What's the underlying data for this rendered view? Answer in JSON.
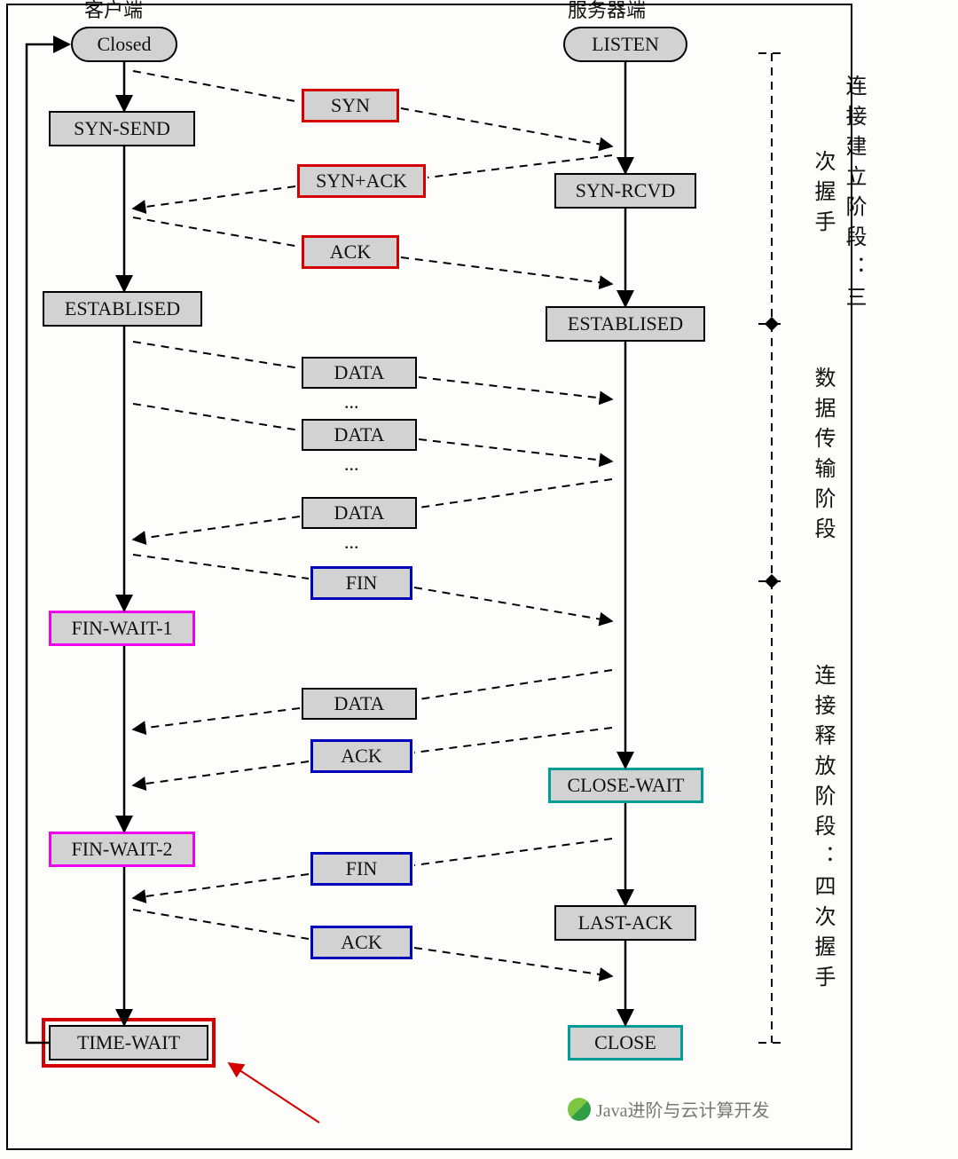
{
  "headers": {
    "client": "客户端",
    "server": "服务器端"
  },
  "phases": {
    "establish": "连接建立阶段：三次握手",
    "transfer": "数据传输阶段",
    "release": "连接释放阶段：四次握手"
  },
  "client_states": {
    "closed": "Closed",
    "syn_send": "SYN-SEND",
    "established": "ESTABLISED",
    "fin_wait_1": "FIN-WAIT-1",
    "fin_wait_2": "FIN-WAIT-2",
    "time_wait": "TIME-WAIT"
  },
  "server_states": {
    "listen": "LISTEN",
    "syn_rcvd": "SYN-RCVD",
    "established": "ESTABLISED",
    "close_wait": "CLOSE-WAIT",
    "last_ack": "LAST-ACK",
    "close": "CLOSE"
  },
  "msgs": {
    "syn": "SYN",
    "syn_ack": "SYN+ACK",
    "ack": "ACK",
    "data": "DATA",
    "fin": "FIN"
  },
  "ellipsis": "...",
  "watermark": "Java进阶与云计算开发"
}
